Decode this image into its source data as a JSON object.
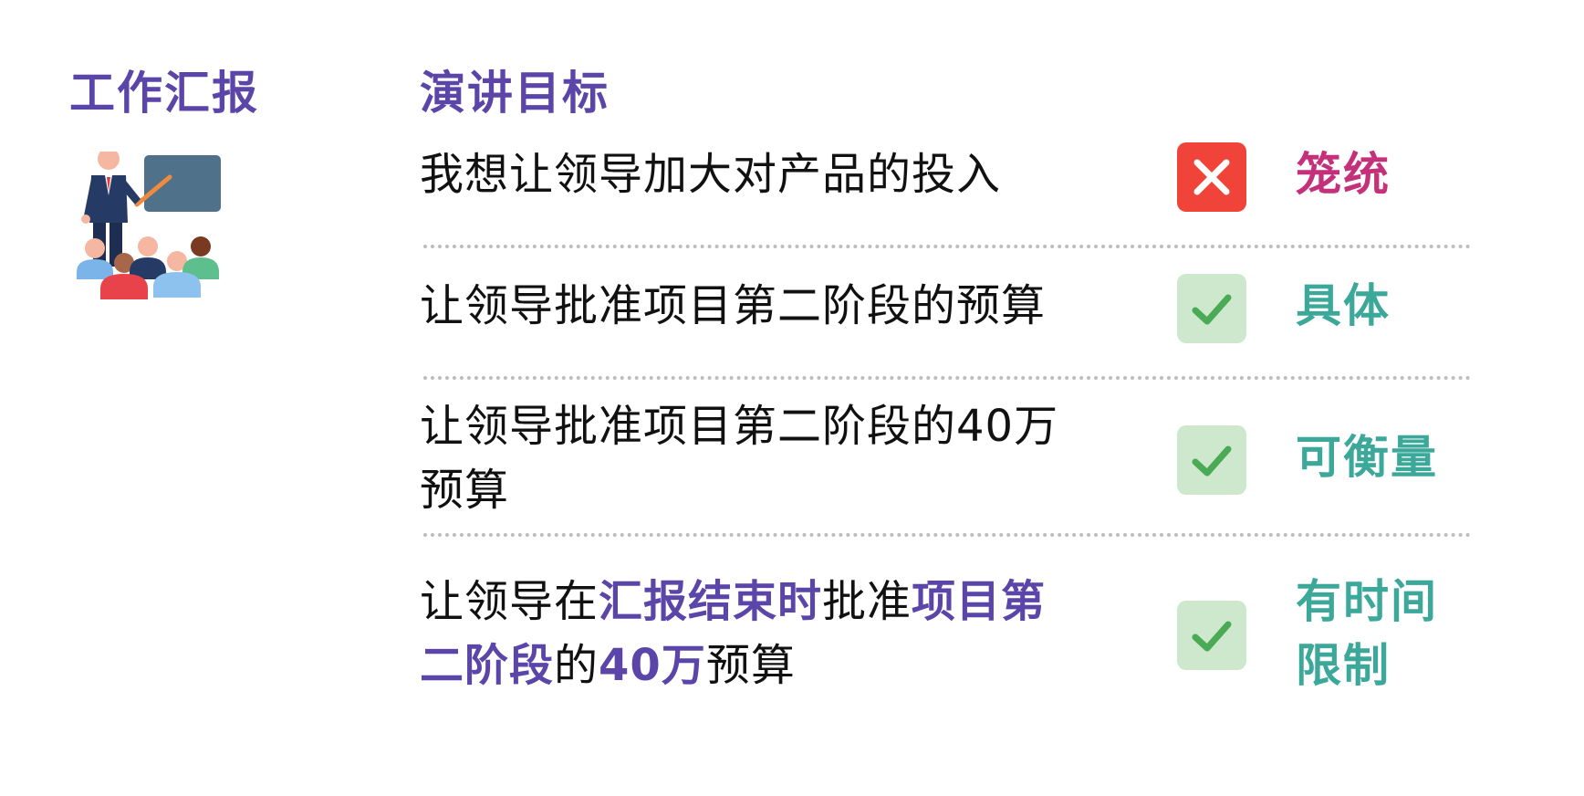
{
  "left_title": "工作汇报",
  "header": {
    "title": "演讲目标"
  },
  "colors": {
    "accent_purple": "#5b45a8",
    "bad_red": "#f0433a",
    "good_green_bg": "#cde8cd",
    "good_green_check": "#4aaa55",
    "verdict_pink": "#c4317a",
    "verdict_teal": "#3ba89a"
  },
  "rows": [
    {
      "text": "我想让领导加大对产品的投入",
      "status": "bad",
      "status_icon": "x-icon",
      "verdict": "笼统"
    },
    {
      "text": "让领导批准项目第二阶段的预算",
      "status": "good",
      "status_icon": "check-icon",
      "verdict": "具体"
    },
    {
      "text_line1": "让领导批准项目第二阶段的40万",
      "text_line2": "预算",
      "status": "good",
      "status_icon": "check-icon",
      "verdict": "可衡量"
    },
    {
      "segments": [
        "让领导在",
        "汇报结束时",
        "批准",
        "项目第",
        "二阶段",
        "的",
        "40万",
        "预算"
      ],
      "status": "good",
      "status_icon": "check-icon",
      "verdict_line1": "有时间",
      "verdict_line2": "限制"
    }
  ]
}
